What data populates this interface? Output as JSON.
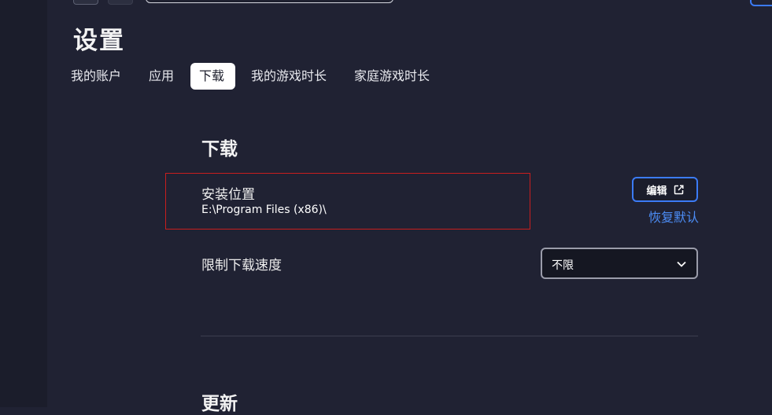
{
  "page": {
    "title": "设置"
  },
  "tabs": [
    {
      "label": "我的账户"
    },
    {
      "label": "应用"
    },
    {
      "label": "下载",
      "active": true
    },
    {
      "label": "我的游戏时长"
    },
    {
      "label": "家庭游戏时长"
    }
  ],
  "downloads": {
    "section_title": "下载",
    "install_location": {
      "label": "安装位置",
      "path": "E:\\Program Files (x86)\\",
      "edit_label": "编辑",
      "reset_label": "恢复默认"
    },
    "speed_limit": {
      "label": "限制下载速度",
      "selected": "不限"
    }
  },
  "updates": {
    "section_title": "更新"
  },
  "colors": {
    "background": "#202233",
    "accent": "#3b7bf6",
    "link": "#4c8df6",
    "highlight": "#c81e1e"
  }
}
